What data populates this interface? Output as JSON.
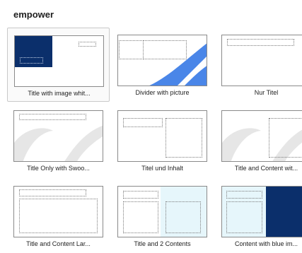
{
  "group": {
    "title": "empower"
  },
  "layouts": [
    {
      "label": "Title with image whit...",
      "selected": true
    },
    {
      "label": "Divider with picture"
    },
    {
      "label": "Nur Titel"
    },
    {
      "label": "Title Only with Swoo..."
    },
    {
      "label": "Titel und Inhalt"
    },
    {
      "label": "Title and Content wit..."
    },
    {
      "label": "Title and Content Lar..."
    },
    {
      "label": "Title and 2 Contents"
    },
    {
      "label": "Content with blue im..."
    }
  ],
  "colors": {
    "navy": "#0b2f6b",
    "swoosh_blue": "#4a86e8",
    "light_cyan": "#e6f6fb",
    "swoosh_gray": "#e6e6e6"
  }
}
